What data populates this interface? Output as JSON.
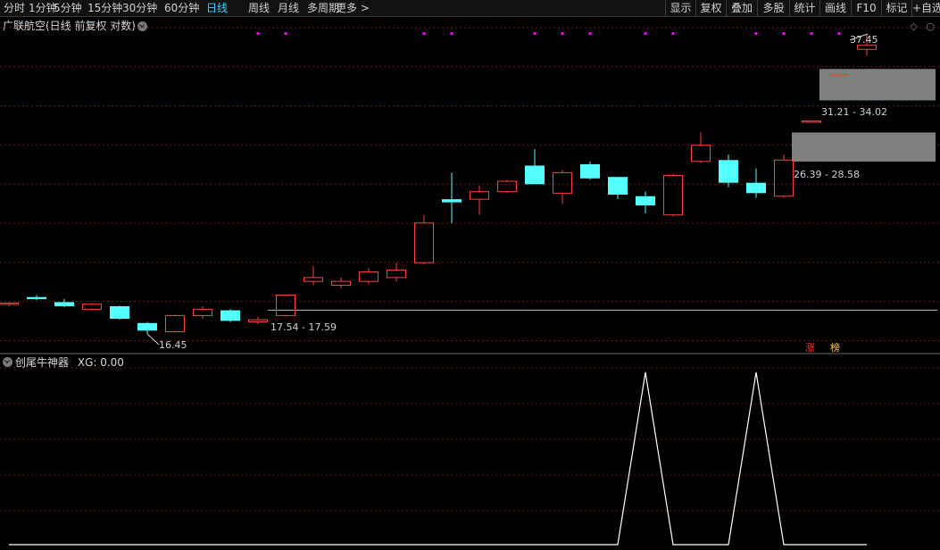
{
  "toolbar": {
    "periods": [
      {
        "label": "分时",
        "active": false
      },
      {
        "label": "1分钟",
        "active": false
      },
      {
        "label": "5分钟",
        "active": false
      },
      {
        "label": "15分钟",
        "active": false
      },
      {
        "label": "30分钟",
        "active": false
      },
      {
        "label": "60分钟",
        "active": false
      },
      {
        "label": "日线",
        "active": true
      },
      {
        "label": "周线",
        "active": false
      },
      {
        "label": "月线",
        "active": false
      },
      {
        "label": "多周期",
        "active": false
      },
      {
        "label": "更多 >",
        "active": false
      }
    ],
    "right_buttons": [
      "显示",
      "复权",
      "叠加",
      "多股",
      "统计",
      "画线",
      "F10",
      "标记",
      "+自选"
    ]
  },
  "chart": {
    "title": "广联航空(日线 前复权 对数)",
    "price_labels": {
      "high": "37.45",
      "low": "16.45",
      "zone_top": "31.21 - 34.02",
      "zone_bottom": "26.39 - 28.58",
      "support": "17.54 - 17.59"
    },
    "badges": {
      "zhang": "涨",
      "bang": "榜"
    }
  },
  "indicator": {
    "name": "创尾牛神器",
    "xg_label": "XG: 0.00"
  },
  "colors": {
    "up": "#ff4040",
    "down": "#54ffff",
    "grid": "#7a1515",
    "signal_dot": "#ff00ff",
    "zone": "#808080",
    "active_tab": "#3fd0ff"
  },
  "chart_data": {
    "type": "candlestick",
    "log_scale": true,
    "candles": [
      {
        "o": 17.9,
        "h": 17.95,
        "l": 17.75,
        "c": 17.85,
        "dir": "up"
      },
      {
        "o": 18.2,
        "h": 18.3,
        "l": 18.05,
        "c": 18.1,
        "dir": "down"
      },
      {
        "o": 17.95,
        "h": 18.1,
        "l": 17.7,
        "c": 17.75,
        "dir": "down"
      },
      {
        "o": 17.6,
        "h": 17.9,
        "l": 17.55,
        "c": 17.85,
        "dir": "up"
      },
      {
        "o": 17.75,
        "h": 17.78,
        "l": 17.1,
        "c": 17.15,
        "dir": "down"
      },
      {
        "o": 16.95,
        "h": 17.0,
        "l": 16.45,
        "c": 16.6,
        "dir": "down"
      },
      {
        "o": 16.55,
        "h": 17.35,
        "l": 16.5,
        "c": 17.3,
        "dir": "up"
      },
      {
        "o": 17.3,
        "h": 17.75,
        "l": 17.15,
        "c": 17.6,
        "dir": "up"
      },
      {
        "o": 17.55,
        "h": 17.6,
        "l": 17.0,
        "c": 17.05,
        "dir": "down"
      },
      {
        "o": 17.0,
        "h": 17.25,
        "l": 16.9,
        "c": 17.1,
        "dir": "up"
      },
      {
        "o": 17.3,
        "h": 18.3,
        "l": 17.25,
        "c": 18.3,
        "dir": "up"
      },
      {
        "o": 19.0,
        "h": 19.8,
        "l": 18.8,
        "c": 19.2,
        "dir": "up"
      },
      {
        "o": 18.8,
        "h": 19.2,
        "l": 18.65,
        "c": 19.0,
        "dir": "up"
      },
      {
        "o": 19.0,
        "h": 19.7,
        "l": 18.85,
        "c": 19.5,
        "dir": "up"
      },
      {
        "o": 19.2,
        "h": 20.0,
        "l": 19.0,
        "c": 19.6,
        "dir": "up"
      },
      {
        "o": 20.0,
        "h": 22.8,
        "l": 19.9,
        "c": 22.3,
        "dir": "up"
      },
      {
        "o": 23.8,
        "h": 25.6,
        "l": 22.3,
        "c": 23.6,
        "dir": "down"
      },
      {
        "o": 23.8,
        "h": 24.7,
        "l": 22.8,
        "c": 24.3,
        "dir": "up"
      },
      {
        "o": 24.3,
        "h": 25.1,
        "l": 24.2,
        "c": 25.0,
        "dir": "up"
      },
      {
        "o": 26.1,
        "h": 27.3,
        "l": 24.8,
        "c": 24.8,
        "dir": "down"
      },
      {
        "o": 24.2,
        "h": 25.8,
        "l": 23.5,
        "c": 25.6,
        "dir": "up"
      },
      {
        "o": 26.2,
        "h": 26.4,
        "l": 25.1,
        "c": 25.2,
        "dir": "down"
      },
      {
        "o": 25.3,
        "h": 25.3,
        "l": 23.8,
        "c": 24.1,
        "dir": "down"
      },
      {
        "o": 24.0,
        "h": 24.3,
        "l": 22.9,
        "c": 23.4,
        "dir": "down"
      },
      {
        "o": 22.8,
        "h": 25.5,
        "l": 22.7,
        "c": 25.4,
        "dir": "up"
      },
      {
        "o": 26.4,
        "h": 28.6,
        "l": 26.3,
        "c": 27.6,
        "dir": "up"
      },
      {
        "o": 26.5,
        "h": 26.9,
        "l": 24.6,
        "c": 24.9,
        "dir": "down"
      },
      {
        "o": 24.9,
        "h": 25.9,
        "l": 23.9,
        "c": 24.2,
        "dir": "down"
      },
      {
        "o": 24.0,
        "h": 26.9,
        "l": 23.9,
        "c": 26.5,
        "dir": "up"
      },
      {
        "o": 29.5,
        "h": 29.5,
        "l": 29.5,
        "c": 29.5,
        "dir": "up"
      },
      {
        "o": 33.5,
        "h": 33.5,
        "l": 33.5,
        "c": 33.5,
        "dir": "up"
      },
      {
        "o": 35.9,
        "h": 37.45,
        "l": 35.3,
        "c": 36.3,
        "dir": "up"
      }
    ],
    "zones": [
      {
        "low": 31.21,
        "high": 34.02
      },
      {
        "low": 26.39,
        "high": 28.58
      }
    ],
    "support_line": 17.56,
    "signal_dots_at": [
      9,
      10,
      15,
      16,
      19,
      20,
      21,
      23,
      24,
      27,
      28,
      29,
      30
    ],
    "xg_series": [
      0,
      0,
      0,
      0,
      0,
      0,
      0,
      0,
      0,
      0,
      0,
      0,
      0,
      0,
      0,
      0,
      0,
      0,
      0,
      0,
      0,
      0,
      0,
      1,
      0,
      0,
      0,
      1,
      0,
      0,
      0,
      0
    ],
    "xg_ylim": [
      0,
      1
    ]
  }
}
